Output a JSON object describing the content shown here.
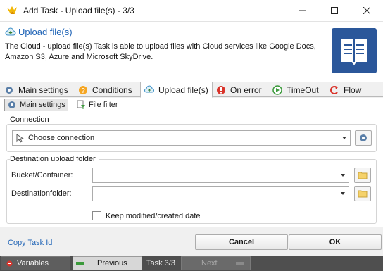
{
  "window": {
    "title": "Add Task - Upload file(s) - 3/3",
    "minimize_icon": "minimize-icon",
    "maximize_icon": "maximize-icon",
    "close_icon": "close-icon"
  },
  "header": {
    "title": "Upload file(s)",
    "description": "The Cloud - upload file(s) Task is able to upload files with Cloud services like Google Docs, Amazon S3, Azure and Microsoft SkyDrive.",
    "book_icon": "book-icon"
  },
  "tabs": [
    {
      "label": "Main settings",
      "icon": "gear-icon",
      "active": false
    },
    {
      "label": "Conditions",
      "icon": "conditions-icon",
      "active": false
    },
    {
      "label": "Upload file(s)",
      "icon": "cloud-upload-icon",
      "active": true
    },
    {
      "label": "On error",
      "icon": "error-icon",
      "active": false
    },
    {
      "label": "TimeOut",
      "icon": "timeout-icon",
      "active": false
    },
    {
      "label": "Flow",
      "icon": "flow-icon",
      "active": false
    }
  ],
  "subtabs": [
    {
      "label": "Main settings",
      "icon": "gear-icon",
      "active": true
    },
    {
      "label": "File filter",
      "icon": "file-filter-icon",
      "active": false
    }
  ],
  "connection": {
    "group_label": "Connection",
    "value": "Choose connection"
  },
  "destination": {
    "group_label": "Destination upload folder",
    "bucket_label": "Bucket/Container:",
    "bucket_value": "",
    "folder_label": "Destinationfolder:",
    "folder_value": "",
    "keep_date_label": "Keep modified/created date",
    "keep_date_checked": false
  },
  "footer": {
    "copy_task_id": "Copy Task Id",
    "cancel_label": "Cancel",
    "ok_label": "OK"
  },
  "statusbar": {
    "variables_label": "Variables",
    "previous_label": "Previous",
    "task_counter": "Task 3/3",
    "next_label": "Next"
  },
  "colors": {
    "accent": "#1e63b6",
    "book_bg": "#2b579a",
    "statusbar_bg": "#4f4f4f"
  }
}
